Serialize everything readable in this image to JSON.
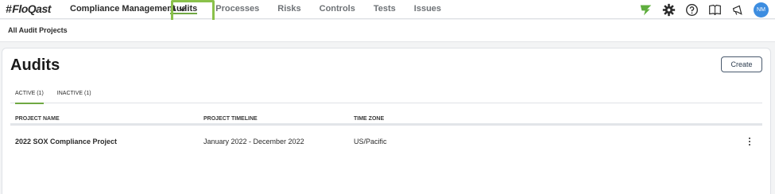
{
  "app": {
    "logo": "FloQast",
    "module": "Compliance Management"
  },
  "nav": [
    {
      "label": "Audits",
      "active": true
    },
    {
      "label": "Processes",
      "active": false
    },
    {
      "label": "Risks",
      "active": false
    },
    {
      "label": "Controls",
      "active": false
    },
    {
      "label": "Tests",
      "active": false
    },
    {
      "label": "Issues",
      "active": false
    }
  ],
  "tools": {
    "icons": [
      "floqast-flag-icon",
      "gear-icon",
      "help-icon",
      "book-icon",
      "megaphone-icon"
    ],
    "avatar_initials": "NM",
    "accent": "#6fa843"
  },
  "breadcrumb": "All Audit Projects",
  "page": {
    "title": "Audits",
    "create_label": "Create",
    "tabs": [
      {
        "label": "ACTIVE (1)",
        "active": true
      },
      {
        "label": "INACTIVE (1)",
        "active": false
      }
    ]
  },
  "table": {
    "columns": [
      "PROJECT NAME",
      "PROJECT TIMELINE",
      "TIME ZONE"
    ],
    "rows": [
      {
        "name": "2022 SOX Compliance Project",
        "timeline": "January 2022 - December 2022",
        "timezone": "US/Pacific"
      }
    ]
  }
}
